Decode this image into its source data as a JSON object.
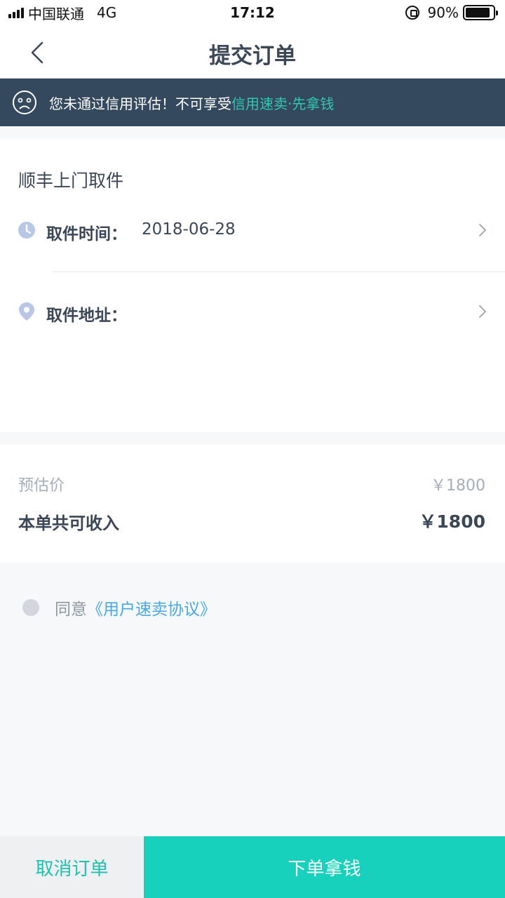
{
  "status_bar": {
    "carrier": "中国联通",
    "network": "4G",
    "time": "17:12",
    "battery_percent": "90%",
    "battery_level": 0.9
  },
  "nav": {
    "title": "提交订单"
  },
  "notice": {
    "text": "您未通过信用评估！不可享受 ",
    "link": "信用速卖·先拿钱",
    "icon": "sad-face-icon"
  },
  "pickup": {
    "title": "顺丰上门取件",
    "time_label": "取件时间：",
    "time_value": "2018-06-28",
    "address_label": "取件地址：",
    "address_value": ""
  },
  "price": {
    "estimate_label": "预估价",
    "estimate_value": "￥1800",
    "income_label": "本单共可收入",
    "income_value": "￥1800"
  },
  "agreement": {
    "text": "同意",
    "link": "《用户速卖协议》"
  },
  "actions": {
    "cancel": "取消订单",
    "submit": "下单拿钱"
  },
  "colors": {
    "accent": "#17d1bd",
    "banner_bg": "#34495e",
    "link": "#4aa8e0"
  }
}
